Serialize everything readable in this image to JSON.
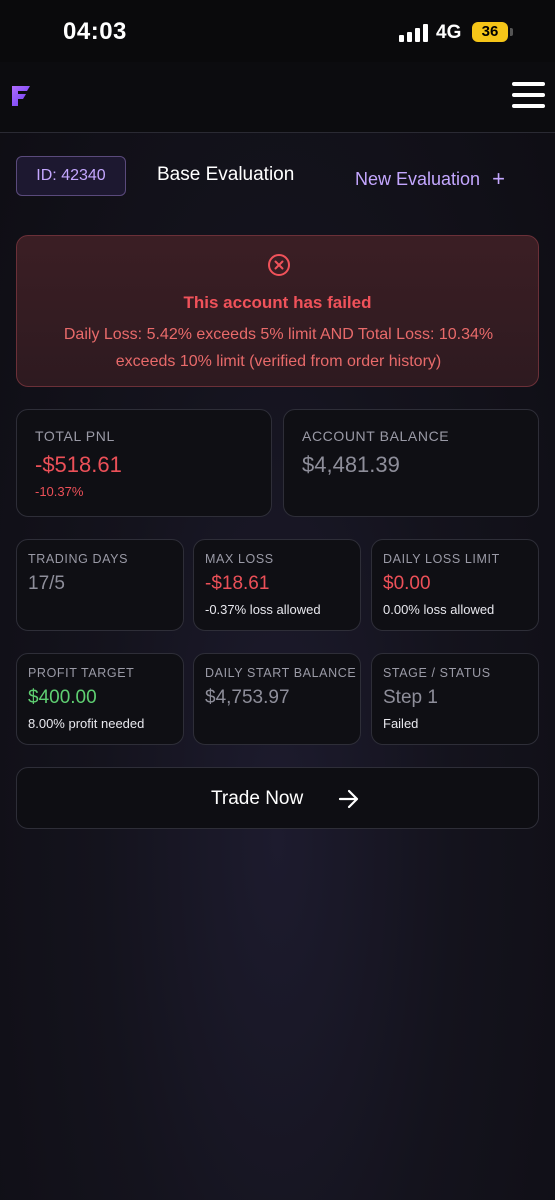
{
  "status_bar": {
    "time": "04:03",
    "network": "4G",
    "battery": "36"
  },
  "header": {
    "logo_icon": "f-logo-icon",
    "menu_icon": "hamburger-menu-icon"
  },
  "account": {
    "id_label": "ID: 42340",
    "title": "Base Evaluation",
    "new_evaluation_label": "New Evaluation",
    "new_evaluation_icon": "plus-icon"
  },
  "alert": {
    "icon": "x-circle-icon",
    "title": "This account has failed",
    "message": "Daily Loss: 5.42% exceeds 5% limit AND Total Loss: 10.34% exceeds 10% limit (verified from order history)"
  },
  "stats": {
    "total_pnl": {
      "label": "TOTAL PNL",
      "value": "-$518.61",
      "sub": "-10.37%"
    },
    "account_balance": {
      "label": "ACCOUNT BALANCE",
      "value": "$4,481.39"
    },
    "trading_days": {
      "label": "TRADING DAYS",
      "value": "17/5"
    },
    "max_loss": {
      "label": "MAX LOSS",
      "value": "-$18.61",
      "sub": "-0.37% loss allowed"
    },
    "daily_loss_limit": {
      "label": "DAILY LOSS LIMIT",
      "value": "$0.00",
      "sub": "0.00% loss allowed"
    },
    "profit_target": {
      "label": "PROFIT TARGET",
      "value": "$400.00",
      "sub": "8.00% profit needed"
    },
    "daily_start_balance": {
      "label": "DAILY START BALANCE",
      "value": "$4,753.97"
    },
    "stage_status": {
      "label": "STAGE / STATUS",
      "value": "Step 1",
      "sub": "Failed"
    }
  },
  "actions": {
    "trade_now_label": "Trade Now",
    "trade_now_icon": "arrow-right-icon"
  },
  "colors": {
    "accent": "#c4a7ff",
    "danger": "#ec5058",
    "success": "#5fcf72"
  }
}
